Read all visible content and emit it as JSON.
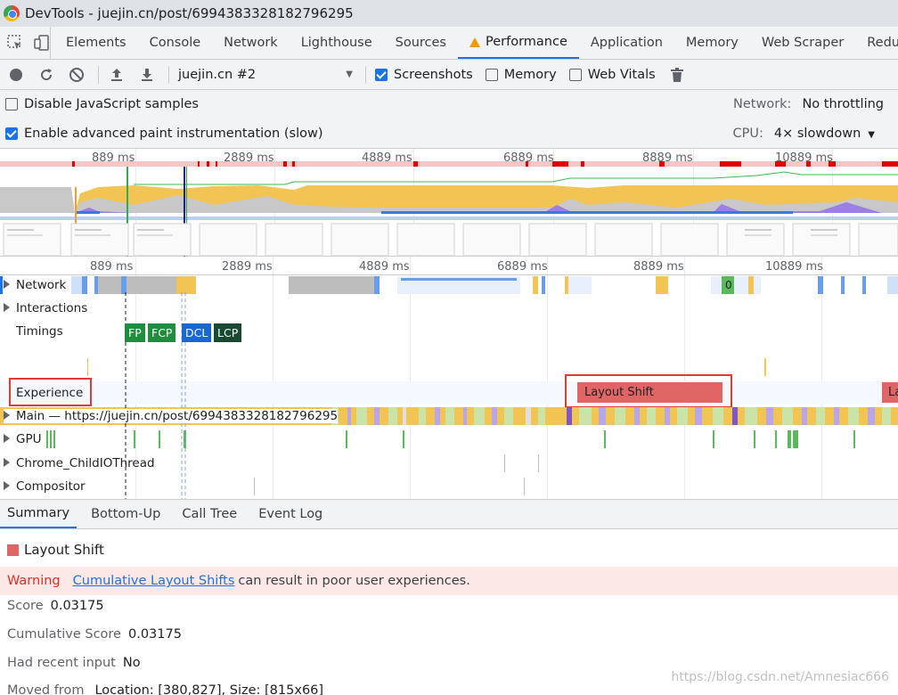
{
  "window": {
    "title": "DevTools - juejin.cn/post/6994383328182796295"
  },
  "tabs": [
    {
      "label": "Elements",
      "active": false
    },
    {
      "label": "Console",
      "active": false
    },
    {
      "label": "Network",
      "active": false
    },
    {
      "label": "Lighthouse",
      "active": false
    },
    {
      "label": "Sources",
      "active": false
    },
    {
      "label": "Performance",
      "active": true,
      "warning": true
    },
    {
      "label": "Application",
      "active": false
    },
    {
      "label": "Memory",
      "active": false
    },
    {
      "label": "Web Scraper",
      "active": false
    },
    {
      "label": "Redu",
      "active": false
    }
  ],
  "toolbar": {
    "profile_select": "juejin.cn #2",
    "screenshots_label": "Screenshots",
    "screenshots_checked": true,
    "memory_label": "Memory",
    "memory_checked": false,
    "web_vitals_label": "Web Vitals",
    "web_vitals_checked": false
  },
  "settings": {
    "disable_js_samples": "Disable JavaScript samples",
    "disable_js_samples_checked": false,
    "advanced_paint": "Enable advanced paint instrumentation (slow)",
    "advanced_paint_checked": true,
    "network_label": "Network:",
    "network_value": "No throttling",
    "cpu_label": "CPU:",
    "cpu_value": "4× slowdown"
  },
  "overview_ruler": [
    "889 ms",
    "2889 ms",
    "4889 ms",
    "6889 ms",
    "8889 ms",
    "10889 ms"
  ],
  "flame_ruler": [
    "889 ms",
    "2889 ms",
    "4889 ms",
    "6889 ms",
    "8889 ms",
    "10889 ms"
  ],
  "tracks": {
    "network": "Network",
    "interactions": "Interactions",
    "timings": "Timings",
    "experience": "Experience",
    "main": "Main — https://juejin.cn/post/6994383328182796295",
    "gpu": "GPU",
    "child_io": "Chrome_ChildIOThread",
    "compositor": "Compositor"
  },
  "timing_markers": [
    "FP",
    "FCP",
    "DCL",
    "LCP"
  ],
  "network_marker": "0",
  "experience_event": "Layout Shift",
  "experience_event_cut": "La",
  "bottom_tabs": [
    "Summary",
    "Bottom-Up",
    "Call Tree",
    "Event Log"
  ],
  "summary": {
    "title": "Layout Shift",
    "warning_label": "Warning",
    "warning_link": "Cumulative Layout Shifts",
    "warning_text": "can result in poor user experiences.",
    "score_label": "Score",
    "score_value": "0.03175",
    "cumulative_label": "Cumulative Score",
    "cumulative_value": "0.03175",
    "recent_input_label": "Had recent input",
    "recent_input_value": "No",
    "moved_from_label": "Moved from",
    "moved_from_value": "Location: [380,827], Size: [815x66]"
  },
  "watermark": "https://blog.csdn.net/Amnesiac666",
  "colors": {
    "accent": "#1a73e8",
    "layout_shift": "#e06666",
    "highlight_box": "#e53935",
    "scripting": "#f1c453",
    "warning_bg": "#fce8e6"
  }
}
